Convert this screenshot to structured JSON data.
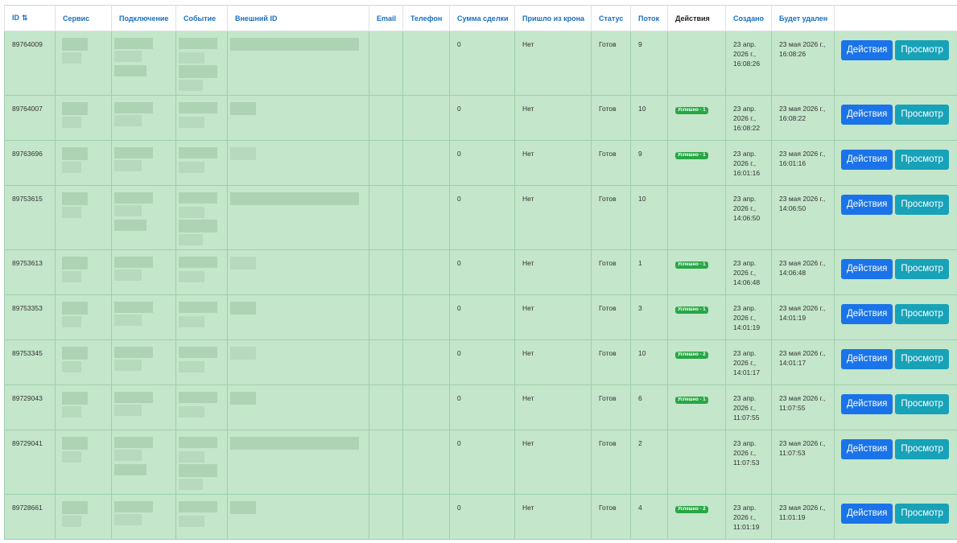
{
  "columns": {
    "id": "ID",
    "service": "Сервис",
    "connection": "Подключение",
    "event": "Событие",
    "external_id": "Внешний ID",
    "email": "Email",
    "phone": "Телефон",
    "deal_sum": "Сумма сделки",
    "from_cron": "Пришло из крона",
    "status": "Статус",
    "thread": "Поток",
    "actions": "Действия",
    "created": "Создано",
    "will_delete": "Будет удален"
  },
  "buttons": {
    "actions": "Действия",
    "view": "Просмотр"
  },
  "rows": [
    {
      "id": "89764009",
      "sum": "0",
      "cron": "Нет",
      "status": "Готов",
      "thread": "9",
      "badge": "",
      "created": "23 апр. 2026 г., 16:08:26",
      "deleted": "23 мая 2026 г., 16:08:26"
    },
    {
      "id": "89764007",
      "sum": "0",
      "cron": "Нет",
      "status": "Готов",
      "thread": "10",
      "badge": "Успешно - 1",
      "created": "23 апр. 2026 г., 16:08:22",
      "deleted": "23 мая 2026 г., 16:08:22"
    },
    {
      "id": "89763696",
      "sum": "0",
      "cron": "Нет",
      "status": "Готов",
      "thread": "9",
      "badge": "Успешно - 1",
      "created": "23 апр. 2026 г., 16:01:16",
      "deleted": "23 мая 2026 г., 16:01:16"
    },
    {
      "id": "89753615",
      "sum": "0",
      "cron": "Нет",
      "status": "Готов",
      "thread": "10",
      "badge": "",
      "created": "23 апр. 2026 г., 14:06:50",
      "deleted": "23 мая 2026 г., 14:06:50"
    },
    {
      "id": "89753613",
      "sum": "0",
      "cron": "Нет",
      "status": "Готов",
      "thread": "1",
      "badge": "Успешно - 1",
      "created": "23 апр. 2026 г., 14:06:48",
      "deleted": "23 мая 2026 г., 14:06:48"
    },
    {
      "id": "89753353",
      "sum": "0",
      "cron": "Нет",
      "status": "Готов",
      "thread": "3",
      "badge": "Успешно - 1",
      "created": "23 апр. 2026 г., 14:01:19",
      "deleted": "23 мая 2026 г., 14:01:19"
    },
    {
      "id": "89753345",
      "sum": "0",
      "cron": "Нет",
      "status": "Готов",
      "thread": "10",
      "badge": "Успешно - 2",
      "created": "23 апр. 2026 г., 14:01:17",
      "deleted": "23 мая 2026 г., 14:01:17"
    },
    {
      "id": "89729043",
      "sum": "0",
      "cron": "Нет",
      "status": "Готов",
      "thread": "6",
      "badge": "Успешно - 1",
      "created": "23 апр. 2026 г., 11:07:55",
      "deleted": "23 мая 2026 г., 11:07:55"
    },
    {
      "id": "89729041",
      "sum": "0",
      "cron": "Нет",
      "status": "Готов",
      "thread": "2",
      "badge": "",
      "created": "23 апр. 2026 г., 11:07:53",
      "deleted": "23 мая 2026 г., 11:07:53"
    },
    {
      "id": "89728661",
      "sum": "0",
      "cron": "Нет",
      "status": "Готов",
      "thread": "4",
      "badge": "Успешно - 2",
      "created": "23 апр. 2026 г., 11:01:19",
      "deleted": "23 мая 2026 г., 11:01:19"
    }
  ]
}
